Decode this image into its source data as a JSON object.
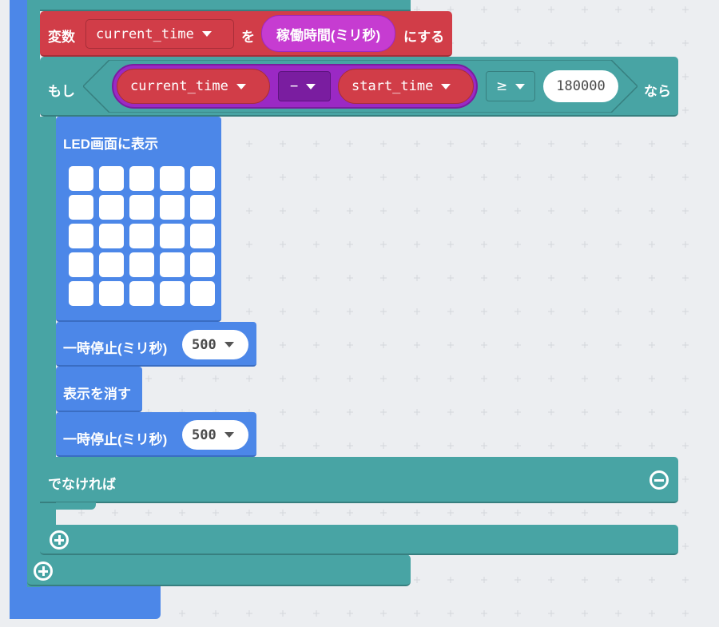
{
  "set_block": {
    "keyword": "変数",
    "variable": "current_time",
    "to_label": "を",
    "value": "稼働時間(ミリ秒)",
    "suffix": "にする"
  },
  "if_block": {
    "keyword": "もし",
    "left_var": "current_time",
    "operator": "−",
    "right_var": "start_time",
    "compare": "≥",
    "threshold": "180000",
    "then_label": "なら"
  },
  "show_leds": {
    "label": "LED画面に表示",
    "rows": 5,
    "cols": 5
  },
  "pause1": {
    "label": "一時停止(ミリ秒)",
    "value": "500"
  },
  "clear": {
    "label": "表示を消す"
  },
  "pause2": {
    "label": "一時停止(ミリ秒)",
    "value": "500"
  },
  "else_block": {
    "label": "でなければ"
  },
  "colors": {
    "variables": "#d13d48",
    "variables_dark": "#a72e38",
    "math": "#9b29c4",
    "math_dark": "#7a1da0",
    "logic": "#48a4a4",
    "logic_dark": "#377f7f",
    "basic": "#4c87e8",
    "basic_dark": "#3a6dc2"
  }
}
